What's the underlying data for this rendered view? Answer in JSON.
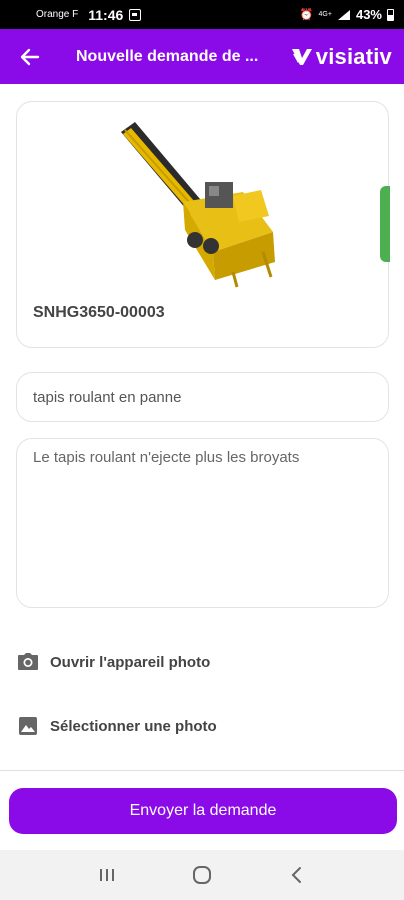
{
  "status_bar": {
    "carrier": "Orange F",
    "time": "11:46",
    "network": "4G+",
    "battery": "43%"
  },
  "header": {
    "title": "Nouvelle demande de ...",
    "brand": "visiativ"
  },
  "machine": {
    "reference": "SNHG3650-00003",
    "image_icon": "conveyor-machine-image"
  },
  "form": {
    "subject_value": "tapis roulant en panne",
    "description_value": "Le tapis roulant n'ejecte plus les broyats"
  },
  "actions": {
    "camera_label": "Ouvrir l'appareil photo",
    "gallery_label": "Sélectionner une photo"
  },
  "submit_label": "Envoyer la demande",
  "colors": {
    "primary": "#8a0be8",
    "side_tab": "#4caf50"
  }
}
